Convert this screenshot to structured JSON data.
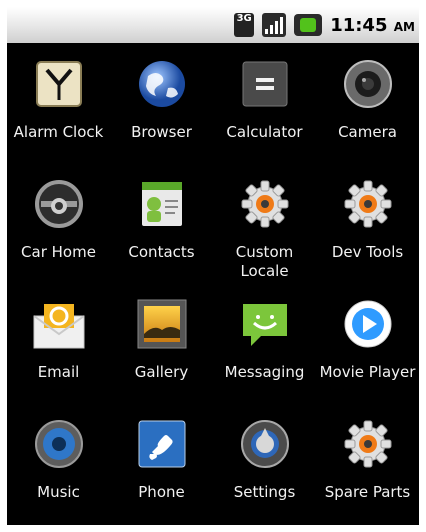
{
  "status_bar": {
    "network_type": "3G",
    "time": "11:45",
    "ampm": "AM"
  },
  "apps": [
    {
      "label": "Alarm Clock",
      "icon": "alarm-clock-icon"
    },
    {
      "label": "Browser",
      "icon": "globe-icon"
    },
    {
      "label": "Calculator",
      "icon": "calculator-icon"
    },
    {
      "label": "Camera",
      "icon": "camera-icon"
    },
    {
      "label": "Car Home",
      "icon": "steering-wheel-icon"
    },
    {
      "label": "Contacts",
      "icon": "contacts-icon"
    },
    {
      "label": "Custom Locale",
      "icon": "gear-icon"
    },
    {
      "label": "Dev Tools",
      "icon": "gear-icon"
    },
    {
      "label": "Email",
      "icon": "email-icon"
    },
    {
      "label": "Gallery",
      "icon": "gallery-icon"
    },
    {
      "label": "Messaging",
      "icon": "message-icon"
    },
    {
      "label": "Movie Player",
      "icon": "play-icon"
    },
    {
      "label": "Music",
      "icon": "speaker-icon"
    },
    {
      "label": "Phone",
      "icon": "phone-icon"
    },
    {
      "label": "Settings",
      "icon": "settings-icon"
    },
    {
      "label": "Spare Parts",
      "icon": "gear-icon"
    }
  ]
}
